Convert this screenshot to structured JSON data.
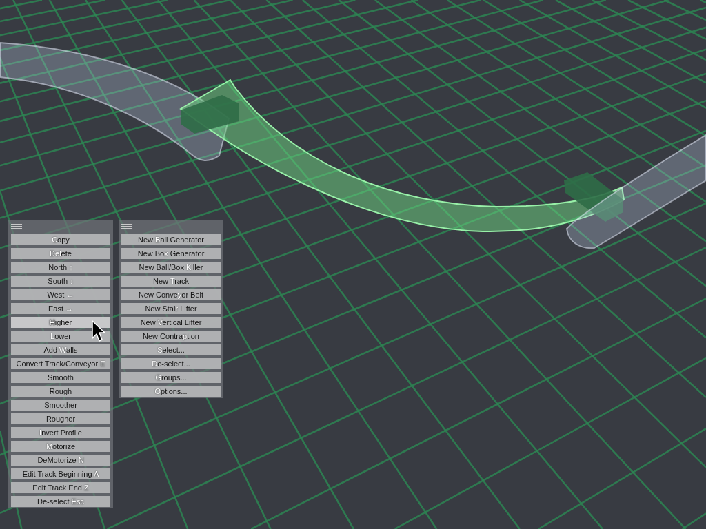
{
  "scene": {
    "tracks": [
      {
        "selected": false
      },
      {
        "selected": true
      },
      {
        "selected": false
      }
    ]
  },
  "menus": [
    {
      "items": [
        {
          "highlighted": false,
          "parts": [
            {
              "text": "C",
              "hotkey": true
            },
            {
              "text": "opy",
              "hotkey": false
            }
          ]
        },
        {
          "highlighted": false,
          "parts": [
            {
              "text": "Del",
              "hotkey": true
            },
            {
              "text": "ete",
              "hotkey": false
            }
          ]
        },
        {
          "highlighted": false,
          "parts": [
            {
              "text": "North ",
              "hotkey": false
            },
            {
              "text": "↑",
              "hotkey": true
            }
          ]
        },
        {
          "highlighted": false,
          "parts": [
            {
              "text": "South ",
              "hotkey": false
            },
            {
              "text": "↓",
              "hotkey": true
            }
          ]
        },
        {
          "highlighted": false,
          "parts": [
            {
              "text": "West ",
              "hotkey": false
            },
            {
              "text": "←",
              "hotkey": true
            }
          ]
        },
        {
          "highlighted": false,
          "parts": [
            {
              "text": "East ",
              "hotkey": false
            },
            {
              "text": "→",
              "hotkey": true
            }
          ]
        },
        {
          "highlighted": true,
          "parts": [
            {
              "text": "H",
              "hotkey": true
            },
            {
              "text": "igher",
              "hotkey": false
            }
          ]
        },
        {
          "highlighted": false,
          "parts": [
            {
              "text": "L",
              "hotkey": true
            },
            {
              "text": "ower",
              "hotkey": false
            }
          ]
        },
        {
          "highlighted": false,
          "parts": [
            {
              "text": "Add ",
              "hotkey": false
            },
            {
              "text": "W",
              "hotkey": true
            },
            {
              "text": "alls",
              "hotkey": false
            }
          ]
        },
        {
          "highlighted": false,
          "parts": [
            {
              "text": "Convert Track/Conveyor ",
              "hotkey": false
            },
            {
              "text": "E",
              "hotkey": true
            }
          ]
        },
        {
          "highlighted": false,
          "parts": [
            {
              "text": "Smooth",
              "hotkey": false
            }
          ]
        },
        {
          "highlighted": false,
          "parts": [
            {
              "text": "Rough",
              "hotkey": false
            }
          ]
        },
        {
          "highlighted": false,
          "parts": [
            {
              "text": "Smoother",
              "hotkey": false
            }
          ]
        },
        {
          "highlighted": false,
          "parts": [
            {
              "text": "Rougher",
              "hotkey": false
            }
          ]
        },
        {
          "highlighted": false,
          "parts": [
            {
              "text": "I",
              "hotkey": true
            },
            {
              "text": "nvert Profile",
              "hotkey": false
            }
          ]
        },
        {
          "highlighted": false,
          "parts": [
            {
              "text": "M",
              "hotkey": true
            },
            {
              "text": "otorize",
              "hotkey": false
            }
          ]
        },
        {
          "highlighted": false,
          "parts": [
            {
              "text": "DeMotorize ",
              "hotkey": false
            },
            {
              "text": "N",
              "hotkey": true
            }
          ]
        },
        {
          "highlighted": false,
          "parts": [
            {
              "text": "Edit Track Beginning ",
              "hotkey": false
            },
            {
              "text": "A",
              "hotkey": true
            }
          ]
        },
        {
          "highlighted": false,
          "parts": [
            {
              "text": "Edit Track End ",
              "hotkey": false
            },
            {
              "text": "Z",
              "hotkey": true
            }
          ]
        },
        {
          "highlighted": false,
          "parts": [
            {
              "text": "De-select ",
              "hotkey": false
            },
            {
              "text": "Esc",
              "hotkey": true
            }
          ]
        }
      ]
    },
    {
      "items": [
        {
          "highlighted": false,
          "parts": [
            {
              "text": "New ",
              "hotkey": false
            },
            {
              "text": "B",
              "hotkey": true
            },
            {
              "text": "all Generator",
              "hotkey": false
            }
          ]
        },
        {
          "highlighted": false,
          "parts": [
            {
              "text": "New Bo",
              "hotkey": false
            },
            {
              "text": "x",
              "hotkey": true
            },
            {
              "text": " Generator",
              "hotkey": false
            }
          ]
        },
        {
          "highlighted": false,
          "parts": [
            {
              "text": "New Ball/Box ",
              "hotkey": false
            },
            {
              "text": "K",
              "hotkey": true
            },
            {
              "text": "iller",
              "hotkey": false
            }
          ]
        },
        {
          "highlighted": false,
          "parts": [
            {
              "text": "New ",
              "hotkey": false
            },
            {
              "text": "T",
              "hotkey": true
            },
            {
              "text": "rack",
              "hotkey": false
            }
          ]
        },
        {
          "highlighted": false,
          "parts": [
            {
              "text": "New Conve",
              "hotkey": false
            },
            {
              "text": "y",
              "hotkey": true
            },
            {
              "text": "or Belt",
              "hotkey": false
            }
          ]
        },
        {
          "highlighted": false,
          "parts": [
            {
              "text": "New Stai",
              "hotkey": false
            },
            {
              "text": "r",
              "hotkey": true
            },
            {
              "text": " Lifter",
              "hotkey": false
            }
          ]
        },
        {
          "highlighted": false,
          "parts": [
            {
              "text": "New ",
              "hotkey": false
            },
            {
              "text": "V",
              "hotkey": true
            },
            {
              "text": "ertical Lifter",
              "hotkey": false
            }
          ]
        },
        {
          "highlighted": false,
          "parts": [
            {
              "text": "New Contra",
              "hotkey": false
            },
            {
              "text": "p",
              "hotkey": true
            },
            {
              "text": "tion",
              "hotkey": false
            }
          ]
        },
        {
          "highlighted": false,
          "parts": [
            {
              "text": "S",
              "hotkey": true
            },
            {
              "text": "elect...",
              "hotkey": false
            }
          ]
        },
        {
          "highlighted": false,
          "parts": [
            {
              "text": "D",
              "hotkey": true
            },
            {
              "text": "e-select...",
              "hotkey": false
            }
          ]
        },
        {
          "highlighted": false,
          "parts": [
            {
              "text": "G",
              "hotkey": true
            },
            {
              "text": "roups...",
              "hotkey": false
            }
          ]
        },
        {
          "highlighted": false,
          "parts": [
            {
              "text": "O",
              "hotkey": true
            },
            {
              "text": "ptions...",
              "hotkey": false
            }
          ]
        }
      ]
    }
  ]
}
